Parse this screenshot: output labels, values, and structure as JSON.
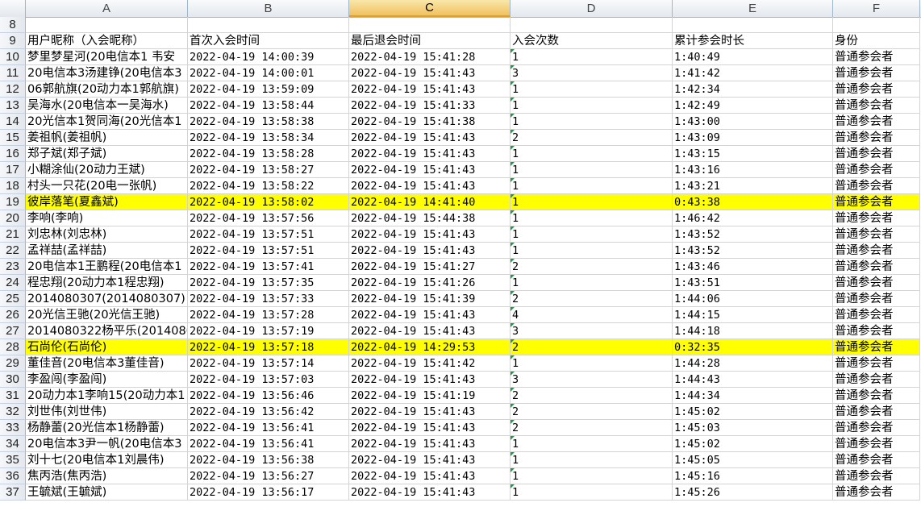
{
  "columns": [
    "A",
    "B",
    "C",
    "D",
    "E",
    "F"
  ],
  "selected_column": "C",
  "row8": {
    "num": "8"
  },
  "header": {
    "num": "9",
    "cells": [
      "用户昵称（入会昵称）",
      "首次入会时间",
      "最后退会时间",
      "入会次数",
      "累计参会时长",
      "身份"
    ]
  },
  "rows": [
    {
      "num": "10",
      "name": "梦里梦星河(20电信本1 韦安",
      "first": "2022-04-19 14:00:39",
      "last": "2022-04-19 15:41:28",
      "count": "1",
      "duration": "1:40:49",
      "role": "普通参会者"
    },
    {
      "num": "11",
      "name": "20电信本3汤建铮(20电信本3",
      "first": "2022-04-19 14:00:01",
      "last": "2022-04-19 15:41:43",
      "count": "3",
      "duration": "1:41:42",
      "role": "普通参会者"
    },
    {
      "num": "12",
      "name": "06郭航旗(20动力本1郭航旗)",
      "first": "2022-04-19 13:59:09",
      "last": "2022-04-19 15:41:43",
      "count": "1",
      "duration": "1:42:34",
      "role": "普通参会者"
    },
    {
      "num": "13",
      "name": "吴海水(20电信本一吴海水)",
      "first": "2022-04-19 13:58:44",
      "last": "2022-04-19 15:41:33",
      "count": "1",
      "duration": "1:42:49",
      "role": "普通参会者"
    },
    {
      "num": "14",
      "name": "20光信本1贺同海(20光信本1",
      "first": "2022-04-19 13:58:38",
      "last": "2022-04-19 15:41:38",
      "count": "1",
      "duration": "1:43:00",
      "role": "普通参会者"
    },
    {
      "num": "15",
      "name": "姜祖帆(姜祖帆)",
      "first": "2022-04-19 13:58:34",
      "last": "2022-04-19 15:41:43",
      "count": "2",
      "duration": "1:43:09",
      "role": "普通参会者"
    },
    {
      "num": "16",
      "name": "郑子斌(郑子斌)",
      "first": "2022-04-19 13:58:28",
      "last": "2022-04-19 15:41:43",
      "count": "1",
      "duration": "1:43:15",
      "role": "普通参会者"
    },
    {
      "num": "17",
      "name": "小糊涂仙(20动力王斌)",
      "first": "2022-04-19 13:58:27",
      "last": "2022-04-19 15:41:43",
      "count": "1",
      "duration": "1:43:16",
      "role": "普通参会者"
    },
    {
      "num": "18",
      "name": "村头一只花(20电一张帆)",
      "first": "2022-04-19 13:58:22",
      "last": "2022-04-19 15:41:43",
      "count": "1",
      "duration": "1:43:21",
      "role": "普通参会者"
    },
    {
      "num": "19",
      "name": "彼岸落笔(夏鑫斌)",
      "first": "2022-04-19 13:58:02",
      "last": "2022-04-19 14:41:40",
      "count": "1",
      "duration": "0:43:38",
      "role": "普通参会者",
      "highlight": true
    },
    {
      "num": "20",
      "name": "李响(李响)",
      "first": "2022-04-19 13:57:56",
      "last": "2022-04-19 15:44:38",
      "count": "1",
      "duration": "1:46:42",
      "role": "普通参会者"
    },
    {
      "num": "21",
      "name": "刘忠林(刘忠林)",
      "first": "2022-04-19 13:57:51",
      "last": "2022-04-19 15:41:43",
      "count": "1",
      "duration": "1:43:52",
      "role": "普通参会者"
    },
    {
      "num": "22",
      "name": "孟祥喆(孟祥喆)",
      "first": "2022-04-19 13:57:51",
      "last": "2022-04-19 15:41:43",
      "count": "1",
      "duration": "1:43:52",
      "role": "普通参会者"
    },
    {
      "num": "23",
      "name": "20电信本1王鹏程(20电信本1",
      "first": "2022-04-19 13:57:41",
      "last": "2022-04-19 15:41:27",
      "count": "2",
      "duration": "1:43:46",
      "role": "普通参会者"
    },
    {
      "num": "24",
      "name": "程忠翔(20动力本1程忠翔)",
      "first": "2022-04-19 13:57:35",
      "last": "2022-04-19 15:41:26",
      "count": "1",
      "duration": "1:43:51",
      "role": "普通参会者"
    },
    {
      "num": "25",
      "name": "2014080307(2014080307)",
      "first": "2022-04-19 13:57:33",
      "last": "2022-04-19 15:41:39",
      "count": "2",
      "duration": "1:44:06",
      "role": "普通参会者"
    },
    {
      "num": "26",
      "name": "20光信王驰(20光信王驰)",
      "first": "2022-04-19 13:57:28",
      "last": "2022-04-19 15:41:43",
      "count": "4",
      "duration": "1:44:15",
      "role": "普通参会者"
    },
    {
      "num": "27",
      "name": "2014080322杨平乐(2014080",
      "first": "2022-04-19 13:57:19",
      "last": "2022-04-19 15:41:43",
      "count": "3",
      "duration": "1:44:18",
      "role": "普通参会者"
    },
    {
      "num": "28",
      "name": "石尚伦(石尚伦)",
      "first": "2022-04-19 13:57:18",
      "last": "2022-04-19 14:29:53",
      "count": "2",
      "duration": "0:32:35",
      "role": "普通参会者",
      "highlight": true
    },
    {
      "num": "29",
      "name": "董佳音(20电信本3董佳音)",
      "first": "2022-04-19 13:57:14",
      "last": "2022-04-19 15:41:42",
      "count": "1",
      "duration": "1:44:28",
      "role": "普通参会者"
    },
    {
      "num": "30",
      "name": "李盈闯(李盈闯)",
      "first": "2022-04-19 13:57:03",
      "last": "2022-04-19 15:41:43",
      "count": "3",
      "duration": "1:44:43",
      "role": "普通参会者"
    },
    {
      "num": "31",
      "name": "20动力本1李响15(20动力本1",
      "first": "2022-04-19 13:56:46",
      "last": "2022-04-19 15:41:19",
      "count": "2",
      "duration": "1:44:34",
      "role": "普通参会者"
    },
    {
      "num": "32",
      "name": "刘世伟(刘世伟)",
      "first": "2022-04-19 13:56:42",
      "last": "2022-04-19 15:41:43",
      "count": "2",
      "duration": "1:45:02",
      "role": "普通参会者"
    },
    {
      "num": "33",
      "name": "杨静蕾(20光信本1杨静蕾)",
      "first": "2022-04-19 13:56:41",
      "last": "2022-04-19 15:41:43",
      "count": "2",
      "duration": "1:45:03",
      "role": "普通参会者"
    },
    {
      "num": "34",
      "name": "20电信本3尹一帆(20电信本3",
      "first": "2022-04-19 13:56:41",
      "last": "2022-04-19 15:41:43",
      "count": "1",
      "duration": "1:45:02",
      "role": "普通参会者"
    },
    {
      "num": "35",
      "name": "刘十七(20电信本1刘晨伟)",
      "first": "2022-04-19 13:56:38",
      "last": "2022-04-19 15:41:43",
      "count": "1",
      "duration": "1:45:05",
      "role": "普通参会者"
    },
    {
      "num": "36",
      "name": "焦丙浩(焦丙浩)",
      "first": "2022-04-19 13:56:27",
      "last": "2022-04-19 15:41:43",
      "count": "1",
      "duration": "1:45:16",
      "role": "普通参会者"
    },
    {
      "num": "37",
      "name": "王毓斌(王毓斌)",
      "first": "2022-04-19 13:56:17",
      "last": "2022-04-19 15:41:43",
      "count": "1",
      "duration": "1:45:26",
      "role": "普通参会者"
    }
  ],
  "colors": {
    "highlight": "#ffff00",
    "selected_header": "#f1c15f",
    "gridline": "#d4d4d4",
    "error_marker": "#1f9e3a"
  }
}
